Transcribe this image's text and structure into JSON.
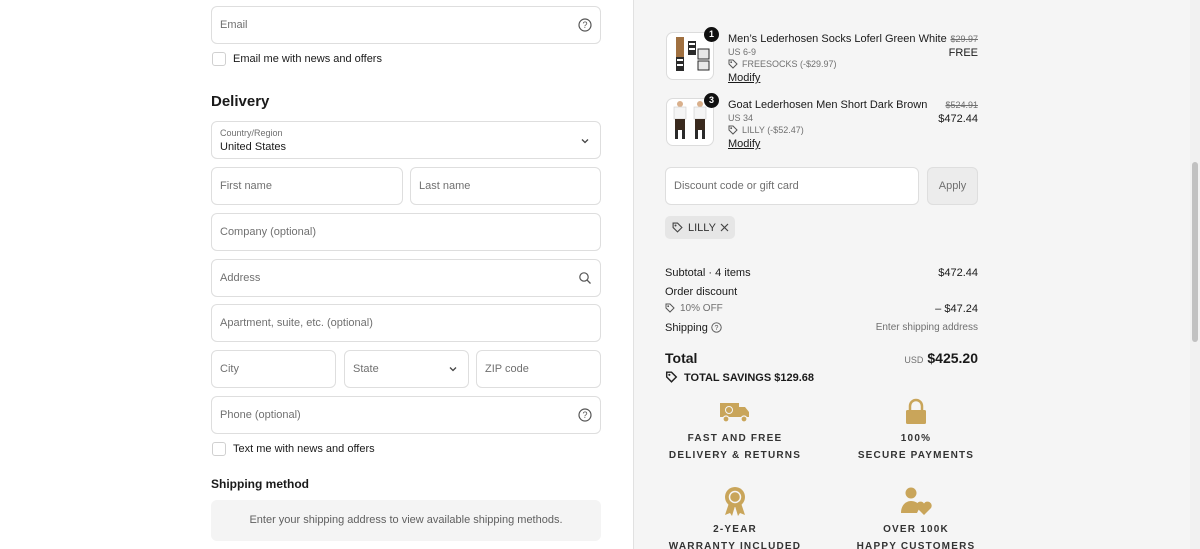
{
  "contact": {
    "email_placeholder": "Email",
    "email_opt_in": "Email me with news and offers"
  },
  "delivery": {
    "heading": "Delivery",
    "country_label": "Country/Region",
    "country_value": "United States",
    "first_name": "First name",
    "last_name": "Last name",
    "company": "Company (optional)",
    "address": "Address",
    "apartment": "Apartment, suite, etc. (optional)",
    "city": "City",
    "state": "State",
    "zip": "ZIP code",
    "phone": "Phone (optional)",
    "sms_opt_in": "Text me with news and offers"
  },
  "shipping_method": {
    "heading": "Shipping method",
    "notice": "Enter your shipping address to view available shipping methods."
  },
  "cart": {
    "items": [
      {
        "qty": "1",
        "name": "Men’s Lederhosen Socks Loferl Green White",
        "variant": "US 6-9",
        "discount": "FREESOCKS (-$29.97)",
        "modify": "Modify",
        "original_price": "$29.97",
        "price": "FREE"
      },
      {
        "qty": "3",
        "name": "Goat Lederhosen Men Short Dark Brown",
        "variant": "US 34",
        "discount": "LILLY (-$52.47)",
        "modify": "Modify",
        "original_price": "$524.91",
        "price": "$472.44"
      }
    ],
    "discount_placeholder": "Discount code or gift card",
    "apply_label": "Apply",
    "applied_code": "LILLY"
  },
  "summary": {
    "subtotal_label": "Subtotal · 4 items",
    "subtotal_value": "$472.44",
    "order_discount_label": "Order discount",
    "order_discount_code": "10% OFF",
    "order_discount_value": "– $47.24",
    "shipping_label": "Shipping",
    "shipping_value": "Enter shipping address",
    "total_label": "Total",
    "currency": "USD",
    "total_value": "$425.20",
    "savings_label": "TOTAL SAVINGS",
    "savings_value": "$129.68"
  },
  "badges": [
    {
      "line1": "FAST AND FREE",
      "line2": "DELIVERY & RETURNS",
      "icon": "delivery-truck-icon"
    },
    {
      "line1": "100%",
      "line2": "SECURE PAYMENTS",
      "icon": "padlock-icon"
    },
    {
      "line1": "2-YEAR",
      "line2": "WARRANTY INCLUDED",
      "icon": "award-ribbon-icon"
    },
    {
      "line1": "OVER 100K",
      "line2": "HAPPY CUSTOMERS",
      "icon": "user-heart-icon"
    }
  ],
  "colors": {
    "accent_gold": "#c9a55a",
    "text": "#1a1a1a",
    "muted": "#707070",
    "panel_bg": "#f5f5f5"
  }
}
